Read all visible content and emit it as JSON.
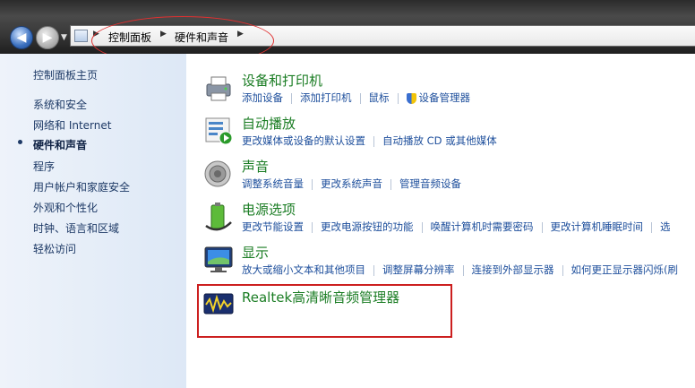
{
  "breadcrumb": {
    "root": "控制面板",
    "current": "硬件和声音"
  },
  "sidebar": {
    "items": [
      {
        "label": "控制面板主页"
      },
      {
        "label": "系统和安全"
      },
      {
        "label": "网络和 Internet"
      },
      {
        "label": "硬件和声音",
        "selected": true
      },
      {
        "label": "程序"
      },
      {
        "label": "用户帐户和家庭安全"
      },
      {
        "label": "外观和个性化"
      },
      {
        "label": "时钟、语言和区域"
      },
      {
        "label": "轻松访问"
      }
    ]
  },
  "categories": [
    {
      "title": "设备和打印机",
      "icon": "printer-icon",
      "links": [
        "添加设备",
        "添加打印机",
        "鼠标",
        "设备管理器"
      ]
    },
    {
      "title": "自动播放",
      "icon": "autoplay-icon",
      "links": [
        "更改媒体或设备的默认设置",
        "自动播放 CD 或其他媒体"
      ]
    },
    {
      "title": "声音",
      "icon": "speaker-icon",
      "links": [
        "调整系统音量",
        "更改系统声音",
        "管理音频设备"
      ]
    },
    {
      "title": "电源选项",
      "icon": "battery-icon",
      "links": [
        "更改节能设置",
        "更改电源按钮的功能",
        "唤醒计算机时需要密码",
        "更改计算机睡眠时间",
        "选"
      ]
    },
    {
      "title": "显示",
      "icon": "monitor-icon",
      "links": [
        "放大或缩小文本和其他项目",
        "调整屏幕分辨率",
        "连接到外部显示器",
        "如何更正显示器闪烁(刷"
      ]
    },
    {
      "title": "Realtek高清晰音频管理器",
      "icon": "realtek-icon",
      "links": []
    }
  ],
  "colors": {
    "category_title": "#1b7d24",
    "link": "#1e4f9c",
    "annotation_red": "#cc1f1f"
  }
}
